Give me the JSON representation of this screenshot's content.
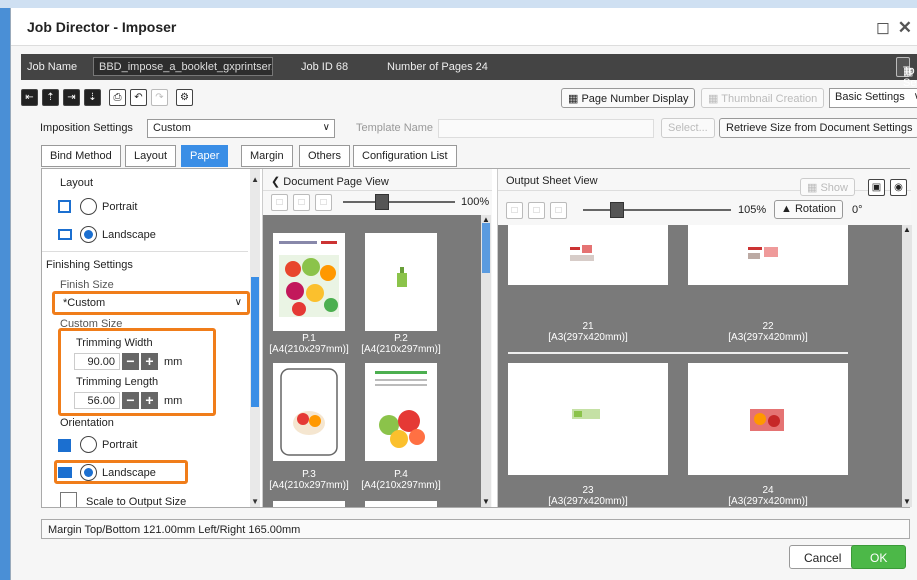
{
  "window": {
    "title": "Job Director - Imposer"
  },
  "info": {
    "job_name_label": "Job Name",
    "job_name_value": "BBD_impose_a_booklet_gxprintser...",
    "job_id": "Job ID  68",
    "pages": "Number of Pages  24",
    "sequencer_label": "To Sequencer"
  },
  "toolbar": {
    "page_number_display": "Page Number Display",
    "thumbnail_creation": "Thumbnail Creation",
    "basic_settings": "Basic Settings"
  },
  "imposition": {
    "label": "Imposition Settings",
    "value": "Custom",
    "template_label": "Template Name",
    "template_value": "",
    "select_label": "Select...",
    "retrieve_label": "Retrieve Size from Document Settings"
  },
  "tabs": [
    "Bind Method",
    "Layout",
    "Paper",
    "Margin",
    "Others",
    "Configuration List"
  ],
  "active_tab": "Paper",
  "left": {
    "layout_heading": "Layout",
    "portrait": "Portrait",
    "landscape": "Landscape",
    "finishing_heading": "Finishing Settings",
    "finish_size_label": "Finish Size",
    "finish_size_value": "*Custom",
    "custom_size_label": "Custom Size",
    "trim_width_label": "Trimming Width",
    "trim_width_value": "90.00",
    "trim_length_label": "Trimming Length",
    "trim_length_value": "56.00",
    "unit": "mm",
    "orientation_heading": "Orientation",
    "orient_portrait": "Portrait",
    "orient_landscape": "Landscape",
    "scale_label": "Scale to Output Size"
  },
  "document_view": {
    "title": "Document Page View",
    "zoom": "100%",
    "pages": [
      {
        "label": "P.1",
        "size": "[A4(210x297mm)]"
      },
      {
        "label": "P.2",
        "size": "[A4(210x297mm)]"
      },
      {
        "label": "P.3",
        "size": "[A4(210x297mm)]"
      },
      {
        "label": "P.4",
        "size": "[A4(210x297mm)]"
      }
    ]
  },
  "output_view": {
    "title": "Output Sheet View",
    "show_label": "Show",
    "zoom": "105%",
    "rotation_label": "Rotation",
    "rotation_value": "0°",
    "sheets": [
      {
        "label": "21",
        "size": "[A3(297x420mm)]"
      },
      {
        "label": "22",
        "size": "[A3(297x420mm)]"
      },
      {
        "label": "23",
        "size": "[A3(297x420mm)]"
      },
      {
        "label": "24",
        "size": "[A3(297x420mm)]"
      }
    ]
  },
  "footer": {
    "margin_text": "Margin  Top/Bottom  121.00mm  Left/Right  165.00mm",
    "cancel": "Cancel",
    "ok": "OK"
  },
  "colors": {
    "accent": "#3a8ee6",
    "highlight": "#f07d1a",
    "ok": "#4cb848"
  }
}
